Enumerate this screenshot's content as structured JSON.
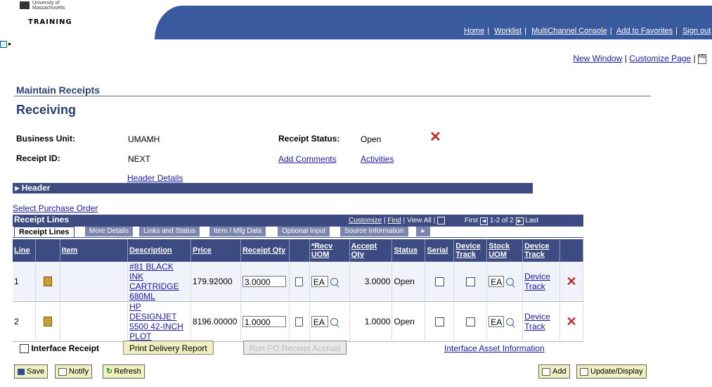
{
  "branding": {
    "university": "University of Massachusetts",
    "environment": "TRAINING"
  },
  "top_nav": [
    "Home",
    "Worklist",
    "MultiChannel Console",
    "Add to Favorites",
    "Sign out"
  ],
  "page_links": {
    "new_window": "New Window",
    "customize_page": "Customize Page",
    "http_label": "http"
  },
  "page_title": "Maintain Receipts",
  "page_heading": "Receiving",
  "fields": {
    "business_unit_label": "Business Unit:",
    "business_unit_value": "UMAMH",
    "receipt_status_label": "Receipt Status:",
    "receipt_status_value": "Open",
    "receipt_id_label": "Receipt ID:",
    "receipt_id_value": "NEXT",
    "add_comments": "Add Comments",
    "activities": "Activities",
    "header_details": "Header Details"
  },
  "header_section": "Header",
  "select_po": "Select Purchase Order",
  "grid": {
    "title": "Receipt Lines",
    "customize": "Customize",
    "find": "Find",
    "view_all": "View All",
    "first": "First",
    "range": "1-2 of 2",
    "last": "Last",
    "tabs": [
      "Receipt Lines",
      "More Details",
      "Links and Status",
      "Item / Mfg Data",
      "Optional Input",
      "Source Information"
    ],
    "columns": [
      "Line",
      "",
      "Item",
      "Description",
      "Price",
      "Receipt Qty",
      "",
      "*Recv UOM",
      "Accept Qty",
      "Status",
      "Serial",
      "Device Track",
      "Stock UOM",
      "Device Track",
      ""
    ],
    "rows": [
      {
        "line": "1",
        "description": "#81 BLACK INK CARTRIDGE 680ML",
        "price": "179.92000",
        "receipt_qty": "3.0000",
        "recv_uom": "EA",
        "accept_qty": "3.0000",
        "status": "Open",
        "stock_uom": "EA",
        "device_track": "Device Track"
      },
      {
        "line": "2",
        "description": "HP DESIGNJET 5500 42-INCH PLOT",
        "price": "8196.00000",
        "receipt_qty": "1.0000",
        "recv_uom": "EA",
        "accept_qty": "1.0000",
        "status": "Open",
        "stock_uom": "EA",
        "device_track": "Device Track"
      }
    ]
  },
  "actions": {
    "interface_receipt": "Interface Receipt",
    "print_delivery": "Print Delivery Report",
    "run_po_accrual": "Run PO Receipt Accrual",
    "interface_asset": "Interface Asset Information"
  },
  "toolbar": {
    "save": "Save",
    "notify": "Notify",
    "refresh": "Refresh",
    "add": "Add",
    "update_display": "Update/Display"
  },
  "colors": {
    "banner": "#3a5aa0",
    "grid_header": "#3c4c82",
    "delete": "#c0282c",
    "button_bg": "#f0f0c0"
  }
}
